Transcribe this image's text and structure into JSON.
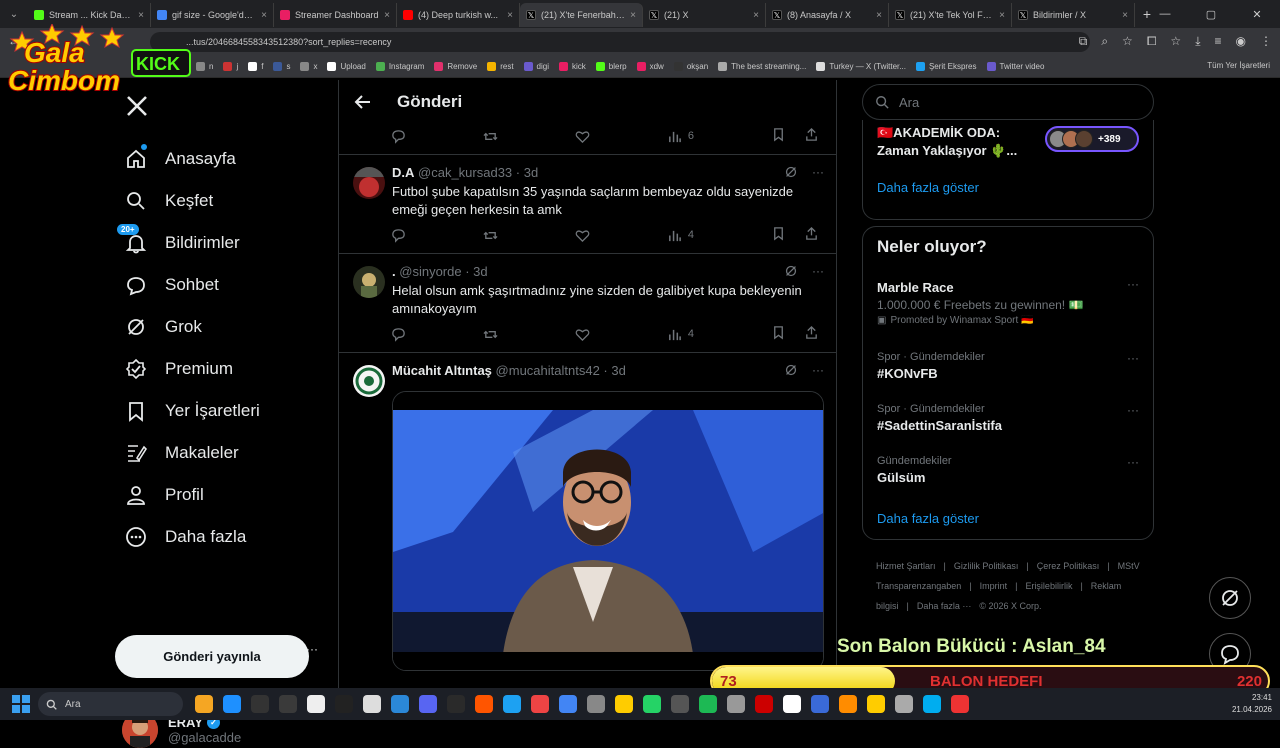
{
  "browser": {
    "tabs": [
      {
        "label": "Stream ... Kick Dashb...",
        "color": "#53fc18",
        "active": false
      },
      {
        "label": "gif size - Google'da Ara",
        "color": "#4285f4",
        "active": false
      },
      {
        "label": "Streamer Dashboard",
        "color": "#e91e63",
        "active": false
      },
      {
        "label": "(4) Deep turkish w...",
        "color": "#ff0000",
        "active": false
      },
      {
        "label": "(21) X'te Fenerbahçe...",
        "color": "#000000",
        "active": true
      },
      {
        "label": "(21) X",
        "color": "#000000",
        "active": false
      },
      {
        "label": "(8) Anasayfa / X",
        "color": "#000000",
        "active": false
      },
      {
        "label": "(21) X'te Tek Yol FENE...",
        "color": "#000000",
        "active": false
      },
      {
        "label": "Bildirimler / X",
        "color": "#000000",
        "active": false
      }
    ],
    "url": "...tus/2046684558343512380?sort_replies=recency",
    "bookmarks": [
      "n",
      "j",
      "f",
      "s",
      "x",
      "Upload",
      "Instagram",
      "Remove",
      "rest",
      "digi",
      "kick",
      "blerp",
      "xdw",
      "okşan",
      "The best streaming...",
      "Turkey — X (Twitter...",
      "Şerit Ekspres",
      "Twitter video"
    ],
    "bookmarks_right": "Tüm Yer İşaretleri"
  },
  "overlay_logo": {
    "line1": "Gala",
    "line2": "Cimbom",
    "tag": "KICK"
  },
  "sidebar": {
    "items": [
      {
        "label": "Anasayfa",
        "icon": "home-icon"
      },
      {
        "label": "Keşfet",
        "icon": "search-icon"
      },
      {
        "label": "Bildirimler",
        "icon": "bell-icon",
        "badge": "20+"
      },
      {
        "label": "Sohbet",
        "icon": "chat-icon"
      },
      {
        "label": "Grok",
        "icon": "grok-icon"
      },
      {
        "label": "Premium",
        "icon": "premium-icon"
      },
      {
        "label": "Yer İşaretleri",
        "icon": "bookmark-icon"
      },
      {
        "label": "Makaleler",
        "icon": "articles-icon"
      },
      {
        "label": "Profil",
        "icon": "profile-icon"
      },
      {
        "label": "Daha fazla",
        "icon": "more-icon"
      }
    ],
    "post_button": "Gönderi yayınla",
    "user": {
      "name": "ERAY",
      "handle": "@galacadde"
    }
  },
  "main": {
    "title": "Gönderi",
    "top_actions": {
      "views": "6"
    },
    "tweets": [
      {
        "name": "D.A",
        "handle": "@cak_kursad33",
        "time": "· 3d",
        "text": "Futbol şube kapatılsın 35 yaşında saçlarım bembeyaz oldu sayenizde emeği geçen herkesin ta amk",
        "views": "4"
      },
      {
        "name": ".",
        "handle": "@sinyorde",
        "time": "· 3d",
        "text": "Helal olsun amk şaşırtmadınız yine sizden de galibiyet kupa bekleyenin amınakoyayım",
        "views": "4"
      },
      {
        "name": "Mücahit Altıntaş",
        "handle": "@mucahitaltnts42",
        "time": "· 3d",
        "text": "",
        "views": ""
      }
    ]
  },
  "right": {
    "search_placeholder": "Ara",
    "space": {
      "name": "🇹🇷AKADEMİK ODA: Zaman Yaklaşıyor 🌵...",
      "count": "+389"
    },
    "show_more": "Daha fazla göster",
    "trends_title": "Neler oluyor?",
    "trends": [
      {
        "meta": "",
        "name": "Marble Race",
        "sub": "1.000.000 € Freebets zu gewinnen! 💵",
        "promo": "Promoted by Winamax Sport 🇩🇪"
      },
      {
        "meta": "Spor · Gündemdekiler",
        "name": "#KONvFB",
        "sub": "",
        "promo": ""
      },
      {
        "meta": "Spor · Gündemdekiler",
        "name": "#SadettinSaranİstifa",
        "sub": "",
        "promo": ""
      },
      {
        "meta": "Gündemdekiler",
        "name": "Gülsüm",
        "sub": "",
        "promo": ""
      }
    ],
    "show_more_2": "Daha fazla göster",
    "footer": [
      "Hizmet Şartları",
      "|",
      "Gizlilik Politikası",
      "|",
      "Çerez Politikası",
      "|",
      "MStV Transparenzangaben",
      "|",
      "Imprint",
      "|",
      "Erişilebilirlik",
      "|",
      "Reklam bilgisi",
      "|",
      "Daha fazla ···",
      "© 2026 X Corp."
    ]
  },
  "stream_overlay": {
    "title": "Son Balon Bükücü : Aslan_84",
    "current": "73",
    "goal_label": "BALON HEDEFI",
    "max": "220",
    "progress": 0.33
  },
  "taskbar": {
    "search": "Ara",
    "time": "23:41",
    "date": "21.04.2026"
  }
}
